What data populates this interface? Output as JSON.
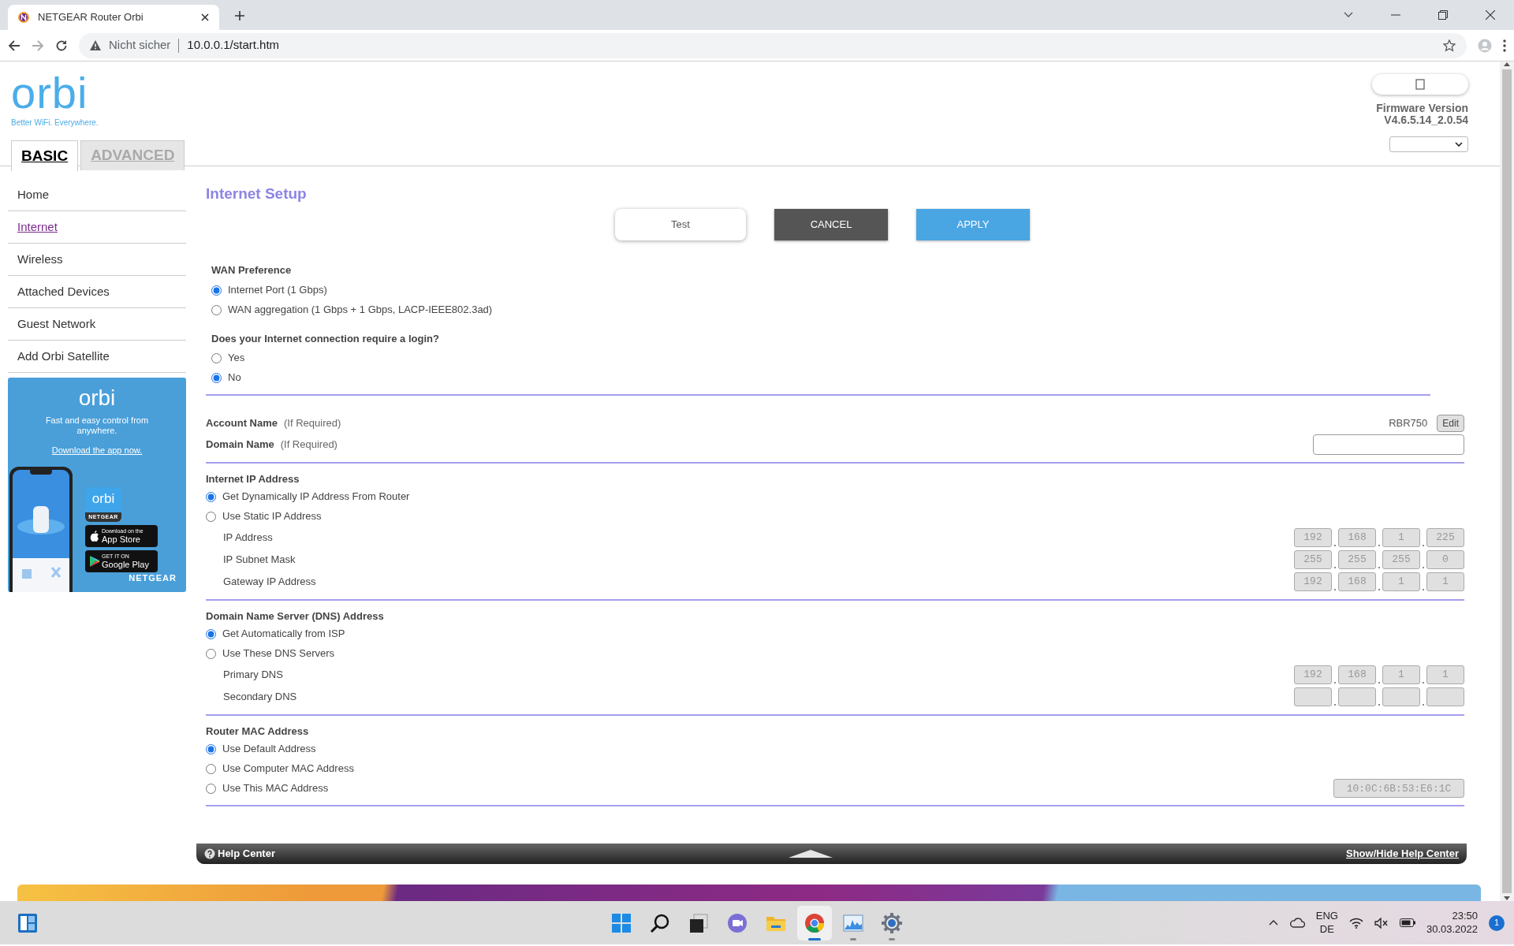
{
  "browser": {
    "tab_title": "NETGEAR Router Orbi",
    "security": "Nicht sicher",
    "url": "10.0.0.1/start.htm"
  },
  "header": {
    "logo": "orbi",
    "tagline": "Better WiFi. Everywhere.",
    "firmware_label": "Firmware Version",
    "firmware_version": "V4.6.5.14_2.0.54"
  },
  "tabs": [
    {
      "label": "BASIC",
      "selected": true
    },
    {
      "label": "ADVANCED",
      "selected": false
    }
  ],
  "sidebar": {
    "items": [
      {
        "label": "Home",
        "selected": false
      },
      {
        "label": "Internet",
        "selected": true
      },
      {
        "label": "Wireless",
        "selected": false
      },
      {
        "label": "Attached Devices",
        "selected": false
      },
      {
        "label": "Guest Network",
        "selected": false
      },
      {
        "label": "Add Orbi Satellite",
        "selected": false
      }
    ]
  },
  "promo": {
    "logo": "orbi",
    "text": "Fast and easy control from anywhere.",
    "link": "Download the app now.",
    "app_logo": "orbi",
    "app_brand": "NETGEAR",
    "app_store_small": "Download on the",
    "app_store": "App Store",
    "play_small": "GET IT ON",
    "play": "Google Play",
    "brand": "NETGEAR"
  },
  "page": {
    "title": "Internet Setup",
    "buttons": [
      {
        "label": "Test",
        "kind": "test"
      },
      {
        "label": "CANCEL",
        "kind": "cancel"
      },
      {
        "label": "APPLY",
        "kind": "apply"
      }
    ]
  },
  "wan_preference": {
    "title": "WAN Preference",
    "options": [
      {
        "label": "Internet Port (1 Gbps)",
        "selected": true
      },
      {
        "label": "WAN aggregation (1 Gbps + 1 Gbps, LACP-IEEE802.3ad)",
        "selected": false
      }
    ]
  },
  "login_required": {
    "title": "Does your Internet connection require a login?",
    "options": [
      {
        "label": "Yes",
        "selected": false
      },
      {
        "label": "No",
        "selected": true
      }
    ]
  },
  "account_name": {
    "label": "Account Name",
    "hint": "(If Required)",
    "value": "RBR750",
    "button": "Edit"
  },
  "domain_name": {
    "label": "Domain Name",
    "hint": "(If Required)"
  },
  "internet_ip": {
    "title": "Internet IP Address",
    "options": [
      {
        "label": "Get Dynamically IP Address From Router",
        "selected": true
      },
      {
        "label": "Use Static IP Address",
        "selected": false
      }
    ],
    "fields": [
      {
        "label": "IP Address",
        "octets": [
          "192",
          "168",
          "1",
          "225"
        ]
      },
      {
        "label": "IP Subnet Mask",
        "octets": [
          "255",
          "255",
          "255",
          "0"
        ]
      },
      {
        "label": "Gateway IP Address",
        "octets": [
          "192",
          "168",
          "1",
          "1"
        ]
      }
    ]
  },
  "dns": {
    "title": "Domain Name Server (DNS) Address",
    "options": [
      {
        "label": "Get Automatically from ISP",
        "selected": true
      },
      {
        "label": "Use These DNS Servers",
        "selected": false
      }
    ],
    "fields": [
      {
        "label": "Primary DNS",
        "octets": [
          "192",
          "168",
          "1",
          "1"
        ]
      },
      {
        "label": "Secondary DNS"
      }
    ]
  },
  "router_mac": {
    "title": "Router MAC Address",
    "options": [
      {
        "label": "Use Default Address",
        "selected": true
      },
      {
        "label": "Use Computer MAC Address",
        "selected": false
      },
      {
        "label": "Use This MAC Address",
        "selected": false,
        "value": "10:0C:6B:53:E6:1C"
      }
    ]
  },
  "help_center": {
    "title": "Help Center",
    "toggle": "Show/Hide Help Center"
  },
  "taskbar": {
    "apps": [
      {
        "kind": "start",
        "selected": false,
        "running": false
      },
      {
        "kind": "search",
        "selected": false,
        "running": false
      },
      {
        "kind": "taskview",
        "selected": false,
        "running": false
      },
      {
        "kind": "chat",
        "selected": false,
        "running": false
      },
      {
        "kind": "explorer",
        "selected": false,
        "running": false
      },
      {
        "kind": "chrome",
        "selected": true,
        "running": true
      },
      {
        "kind": "monitor",
        "selected": false,
        "running": true
      },
      {
        "kind": "settings",
        "selected": false,
        "running": true
      }
    ],
    "language": "ENG",
    "region": "DE",
    "time": "23:50",
    "date": "30.03.2022",
    "notifications": "1"
  }
}
